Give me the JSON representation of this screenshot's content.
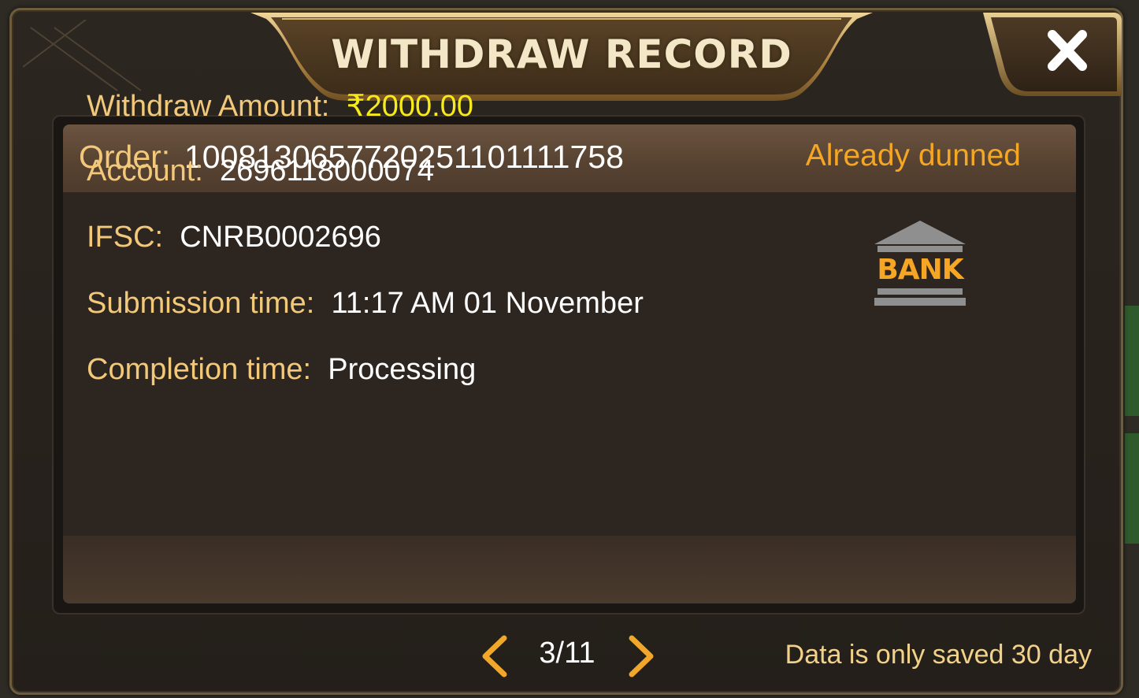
{
  "dialog": {
    "title": "WITHDRAW RECORD",
    "close_icon": "close-x-icon"
  },
  "record": {
    "order_label": "Order:",
    "order_number": "1008130657720251101111758",
    "status": "Already dunned",
    "fields": [
      {
        "label": "Withdraw Amount:",
        "value": "₹2000.00"
      },
      {
        "label": "Account:",
        "value": "2696118000074"
      },
      {
        "label": "IFSC:",
        "value": "CNRB0002696"
      },
      {
        "label": "Submission time:",
        "value": "11:17 AM 01 November"
      },
      {
        "label": "Completion time:",
        "value": "Processing"
      }
    ],
    "method_icon": "bank-icon",
    "method_label": "BANK"
  },
  "pager": {
    "prev_icon": "chevron-left-icon",
    "next_icon": "chevron-right-icon",
    "current": "3/11"
  },
  "note": "Data is only saved 30 day",
  "colors": {
    "label_gold": "#f2c97a",
    "status_orange": "#f5a623",
    "amount_yellow": "#f7ea19",
    "value_white": "#ffffff"
  }
}
